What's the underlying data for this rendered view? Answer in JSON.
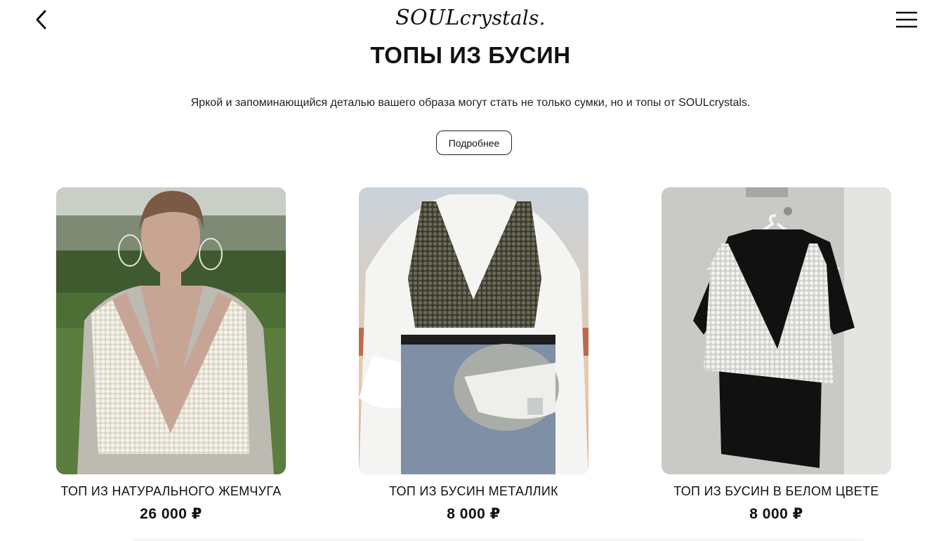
{
  "header": {
    "logo_main": "SOUL",
    "logo_tail": "crystals.",
    "back_icon": "chevron-left-icon",
    "menu_icon": "hamburger-menu-icon"
  },
  "section": {
    "title": "ТОПЫ ИЗ БУСИН",
    "intro": "Яркой и запоминающийся деталью вашего образа могут стать не только сумки, но и топы от SOULcrystals.",
    "more_label": "Подробнее"
  },
  "products": [
    {
      "name": "ТОП ИЗ НАТУРАЛЬНОГО ЖЕМЧУГА",
      "price": "26 000 ₽"
    },
    {
      "name": "ТОП ИЗ БУСИН МЕТАЛЛИК",
      "price": "8 000 ₽"
    },
    {
      "name": "ТОП ИЗ БУСИН В БЕЛОМ ЦВЕТЕ",
      "price": "8 000 ₽"
    }
  ],
  "colors": {
    "text": "#111111",
    "background": "#ffffff",
    "pearl": "#ece8de",
    "metallic": "#4a4838"
  }
}
